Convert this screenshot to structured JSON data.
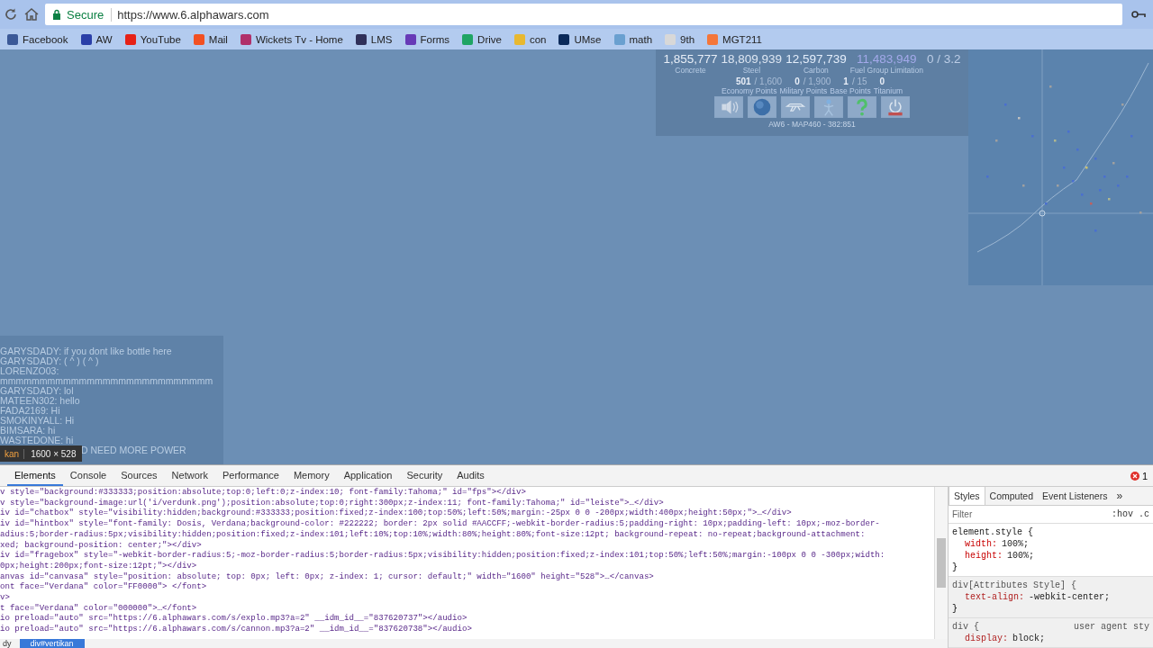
{
  "browser": {
    "security_label": "Secure",
    "url": "https://www.6.alphawars.com",
    "bookmarks": [
      {
        "label": "Facebook",
        "color": "#3b5998"
      },
      {
        "label": "AW",
        "color": "#2a3fa8"
      },
      {
        "label": "YouTube",
        "color": "#e62117"
      },
      {
        "label": "Mail",
        "color": "#f25022"
      },
      {
        "label": "Wickets Tv - Home",
        "color": "#b0306a"
      },
      {
        "label": "LMS",
        "color": "#30305a"
      },
      {
        "label": "Forms",
        "color": "#673ab7"
      },
      {
        "label": "Drive",
        "color": "#1fa463"
      },
      {
        "label": "con",
        "color": "#e8b830"
      },
      {
        "label": "UMse",
        "color": "#0b2a5a"
      },
      {
        "label": "math",
        "color": "#6aa0d0"
      },
      {
        "label": "9th",
        "color": "#d8d8d8"
      },
      {
        "label": "MGT211",
        "color": "#f4763a"
      }
    ]
  },
  "game": {
    "resources": [
      {
        "value": "1,855,777",
        "label": "Concrete",
        "color": "#e8eef7"
      },
      {
        "value": "18,809,939",
        "label": "Steel",
        "color": "#dde6f2"
      },
      {
        "value": "12,597,739",
        "label": "Carbon",
        "color": "#e4eefb"
      },
      {
        "value": "11,483,949",
        "label": "Fuel Group Limitation",
        "color": "#a3a9ea"
      },
      {
        "value": "0 / 3.2",
        "color": "#bccde6"
      }
    ],
    "points": [
      {
        "current": "501",
        "max": "/ 1,600"
      },
      {
        "current": "0",
        "max": "/ 1,900"
      },
      {
        "current": "1",
        "max": "/ 15"
      },
      {
        "current": "0"
      }
    ],
    "point_labels": [
      "Economy Points",
      "Military Points",
      "Base Points",
      "Titanium"
    ],
    "action_buttons": [
      {
        "kind": "sound"
      },
      {
        "kind": "globe"
      },
      {
        "kind": "plane"
      },
      {
        "kind": "figure"
      },
      {
        "kind": "help"
      },
      {
        "kind": "power"
      }
    ],
    "location": "AW6 - MAP460 - 382:851",
    "chat": [
      "GARYSDADY: if you dont like bottle here",
      "GARYSDADY: ( ^ ) ( ^ )",
      "LORENZO03:",
      "mmmmmmmmmmmmmmmmmmmmmmmmmmm",
      "GARYSDADY: lol",
      "MATEEN302: hello",
      "FADA2169: Hi",
      "SMOKINYALL: Hi",
      "BIMSARA: hi",
      "WASTEDONE: hi"
    ],
    "chat_partial": "D NEED MORE POWER",
    "inspector_tooltip": {
      "element": "kan",
      "size": "1600 × 528"
    }
  },
  "devtools": {
    "tabs": [
      {
        "label": "Elements",
        "selected": true
      },
      {
        "label": "Console",
        "selected": false
      },
      {
        "label": "Sources",
        "selected": false
      },
      {
        "label": "Network",
        "selected": false
      },
      {
        "label": "Performance",
        "selected": false
      },
      {
        "label": "Memory",
        "selected": false
      },
      {
        "label": "Application",
        "selected": false
      },
      {
        "label": "Security",
        "selected": false
      },
      {
        "label": "Audits",
        "selected": false
      }
    ],
    "error_count": "1",
    "code_lines": [
      "v style=\"background:#333333;position:absolute;top:0;left:0;z-index:10; font-family:Tahoma;\" id=\"fps\"></div>",
      "v style=\"background-image:url('i/verdunk.png');position:absolute;top:0;right:300px;z-index:11; font-family:Tahoma;\" id=\"leiste\">…</div>",
      "iv id=\"chatbox\" style=\"visibility:hidden;background:#333333;position:fixed;z-index:100;top:50%;left:50%;margin:-25px 0 0 -200px;width:400px;height:50px;\">…</div>",
      "iv id=\"hintbox\" style=\"font-family: Dosis, Verdana;background-color: #222222; border: 2px solid #AACCFF;-webkit-border-radius:5;padding-right: 10px;padding-left: 10px;-moz-border-",
      "adius:5;border-radius:5px;visibility:hidden;position:fixed;z-index:101;left:10%;top:10%;width:80%;height:80%;font-size:12pt; background-repeat: no-repeat;background-attachment:",
      "xed; background-position: center;\"></div>",
      "iv id=\"fragebox\" style=\"-webkit-border-radius:5;-moz-border-radius:5;border-radius:5px;visibility:hidden;position:fixed;z-index:101;top:50%;left:50%;margin:-100px 0 0 -300px;width:",
      "0px;height:200px;font-size:12pt;\"></div>",
      "anvas id=\"canvasa\" style=\"position: absolute; top: 0px; left: 0px; z-index: 1; cursor: default;\" width=\"1600\" height=\"528\">…</canvas>",
      "ont face=\"Verdana\" color=\"FF0000\"> </font>",
      "v>",
      "t face=\"Verdana\" color=\"000000\">…</font>",
      "io preload=\"auto\" src=\"https://6.alphawars.com/s/explo.mp3?a=2\" __idm_id__=\"837620737\"></audio>",
      "io preload=\"auto\" src=\"https://6.alphawars.com/s/cannon.mp3?a=2\" __idm_id__=\"837620738\"></audio>"
    ],
    "breadcrumbs": [
      {
        "label": "dy",
        "selected": false
      },
      {
        "label": "div#vertikan",
        "selected": true
      }
    ],
    "styles_pane": {
      "tabs": [
        {
          "label": "Styles",
          "selected": true
        },
        {
          "label": "Computed",
          "selected": false
        },
        {
          "label": "Event Listeners",
          "selected": false
        }
      ],
      "more": "»",
      "filter_placeholder": "Filter",
      "toggles": [
        ":hov",
        ".c"
      ],
      "rules": [
        {
          "selector": "element.style {",
          "shaded": false,
          "declarations": [
            {
              "property": "width:",
              "value": "100%;"
            },
            {
              "property": "height:",
              "value": "100%;"
            }
          ],
          "close": "}"
        },
        {
          "selector": "div[Attributes Style] {",
          "shaded": true,
          "declarations": [
            {
              "property": "text-align:",
              "value": "-webkit-center;"
            }
          ],
          "close": "}"
        },
        {
          "selector": "div {",
          "source": "user agent sty",
          "shaded": true,
          "declarations": [
            {
              "property": "display:",
              "value": "block;"
            }
          ]
        }
      ]
    }
  }
}
